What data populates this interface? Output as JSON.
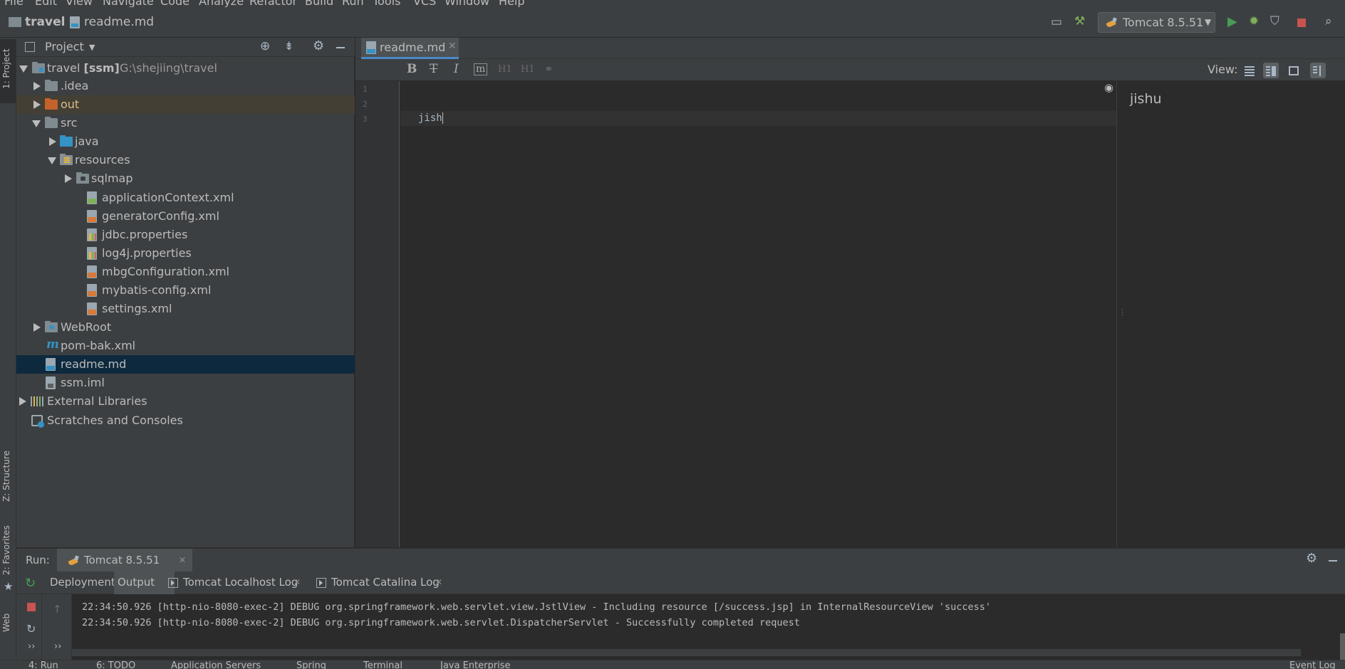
{
  "menu": [
    "File",
    "Edit",
    "View",
    "Navigate",
    "Code",
    "Analyze",
    "Refactor",
    "Build",
    "Run",
    "Tools",
    "VCS",
    "Window",
    "Help"
  ],
  "breadcrumb": {
    "project": "travel",
    "file": "readme.md"
  },
  "run_config": {
    "label": "Tomcat 8.5.51"
  },
  "left_strip": {
    "project_tab": "1: Project",
    "structure_tab": "Z: Structure",
    "favorites_tab": "2: Favorites",
    "web_tab": "Web"
  },
  "project_panel": {
    "title": "Project",
    "tree": [
      {
        "label": "travel",
        "module": "[ssm]",
        "path": "G:\\shejiing\\travel"
      },
      {
        "label": ".idea"
      },
      {
        "label": "out"
      },
      {
        "label": "src"
      },
      {
        "label": "java"
      },
      {
        "label": "resources"
      },
      {
        "label": "sqlmap"
      },
      {
        "label": "applicationContext.xml"
      },
      {
        "label": "generatorConfig.xml"
      },
      {
        "label": "jdbc.properties"
      },
      {
        "label": "log4j.properties"
      },
      {
        "label": "mbgConfiguration.xml"
      },
      {
        "label": "mybatis-config.xml"
      },
      {
        "label": "settings.xml"
      },
      {
        "label": "WebRoot"
      },
      {
        "label": "pom-bak.xml"
      },
      {
        "label": "readme.md"
      },
      {
        "label": "ssm.iml"
      },
      {
        "label": "External Libraries"
      },
      {
        "label": "Scratches and Consoles"
      }
    ]
  },
  "editor": {
    "tab_label": "readme.md",
    "toolbar": {
      "bold": "B",
      "strike": "T",
      "italic": "I",
      "code": "m",
      "h1": "H1",
      "h2": "H1",
      "view_label": "View:"
    },
    "line_numbers": [
      "1",
      "2",
      "3"
    ],
    "line3_text": "jish",
    "preview_text": "jishu"
  },
  "run_panel": {
    "label": "Run:",
    "config_tab": "Tomcat 8.5.51",
    "tabs": [
      "Deployment",
      "Output",
      "Tomcat Localhost Log",
      "Tomcat Catalina Log"
    ],
    "log_lines": [
      "22:34:50.926 [http-nio-8080-exec-2] DEBUG org.springframework.web.servlet.view.JstlView - Including resource [/success.jsp] in InternalResourceView 'success'",
      "22:34:50.926 [http-nio-8080-exec-2] DEBUG org.springframework.web.servlet.DispatcherServlet - Successfully completed request"
    ]
  },
  "bottom_tabs": [
    "4: Run",
    "6: TODO",
    "Application Servers",
    "Spring",
    "Terminal",
    "Java Enterprise",
    "Event Log"
  ],
  "colors": {
    "accent": "#4a88c7",
    "run_green": "#499c54",
    "stop_red": "#c75450",
    "selection": "#0d293e"
  }
}
